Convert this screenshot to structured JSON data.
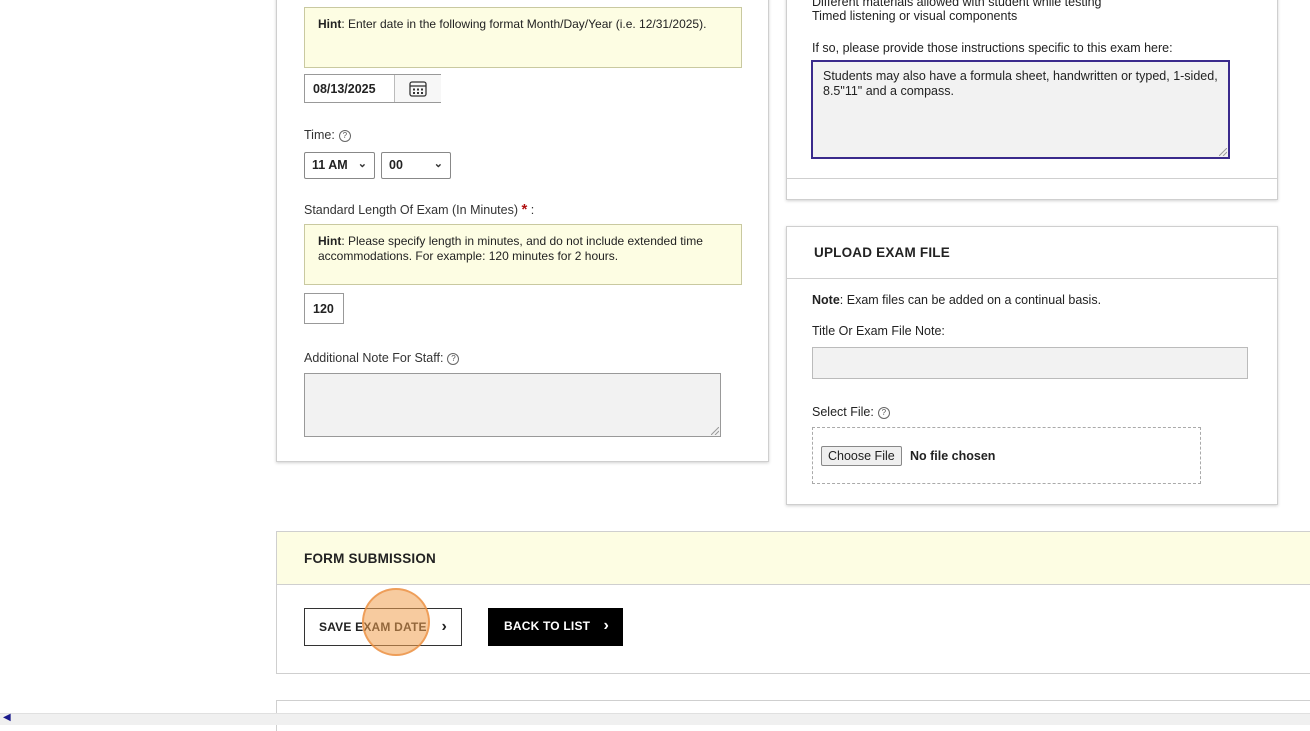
{
  "left_panel": {
    "date_hint_bold": "Hint",
    "date_hint_text": ": Enter date in the following format Month/Day/Year (i.e. 12/31/2025).",
    "date_value": "08/13/2025",
    "time_label": "Time:",
    "hour_value": "11 AM",
    "minute_value": "00",
    "length_label": "Standard Length Of Exam (In Minutes)",
    "length_hint_bold": "Hint",
    "length_hint_text": ": Please specify length in minutes, and do not include extended time accommodations. For example: 120 minutes for 2 hours.",
    "length_value": "120",
    "note_label": "Additional Note For Staff:",
    "note_value": ""
  },
  "instructions_panel": {
    "line_partial": "Different materials allowed with student while testing",
    "line_timed": "Timed listening or visual components",
    "prompt": "If so, please provide those instructions specific to this exam here:",
    "textarea_value": "Students may also have a formula sheet, handwritten or typed, 1-sided, 8.5\"11\" and a compass."
  },
  "upload_panel": {
    "title": "UPLOAD EXAM FILE",
    "note_bold": "Note",
    "note_text": ": Exam files can be added on a continual basis.",
    "title_label": "Title Or Exam File Note:",
    "title_value": "",
    "file_label": "Select File:",
    "choose_button": "Choose File",
    "file_status": "No file chosen"
  },
  "submission": {
    "title": "FORM SUBMISSION",
    "save_button": "SAVE EXAM DATE",
    "back_button": "BACK TO LIST"
  },
  "icons": {
    "help": "help-circle-icon",
    "calendar": "calendar-icon",
    "chevron": "chevron-right-icon"
  },
  "colors": {
    "hint_bg": "#fdfde3",
    "submission_bg": "#fdfde3",
    "focus_border": "#3a2a8c",
    "required": "#b01010",
    "back_button_bg": "#000000",
    "click_marker": "#f0a050"
  }
}
